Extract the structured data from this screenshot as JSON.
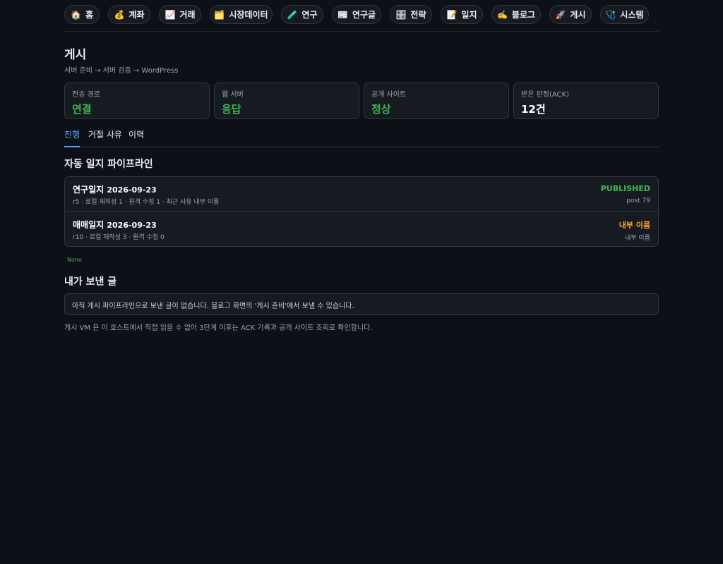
{
  "nav": [
    {
      "icon": "🏠",
      "label": "홈"
    },
    {
      "icon": "💰",
      "label": "계좌"
    },
    {
      "icon": "📈",
      "label": "거래"
    },
    {
      "icon": "🗂️",
      "label": "시장데이터"
    },
    {
      "icon": "🧪",
      "label": "연구"
    },
    {
      "icon": "📰",
      "label": "연구글"
    },
    {
      "icon": "🎛️",
      "label": "전략"
    },
    {
      "icon": "📝",
      "label": "일지"
    },
    {
      "icon": "✍️",
      "label": "블로그"
    },
    {
      "icon": "🚀",
      "label": "게시"
    },
    {
      "icon": "🩺",
      "label": "시스템"
    }
  ],
  "page": {
    "title": "게시",
    "breadcrumb": "서버 준비 → 서버 검증 → WordPress"
  },
  "cards": [
    {
      "label": "전송 경로",
      "value": "연결",
      "color": "#3fb950"
    },
    {
      "label": "웹 서버",
      "value": "응답",
      "color": "#3fb950"
    },
    {
      "label": "공개 사이트",
      "value": "정상",
      "color": "#3fb950"
    },
    {
      "label": "받은 판정(ACK)",
      "value": "12건",
      "color": "#ffffff"
    }
  ],
  "tabs": [
    {
      "label": "진행",
      "active": true
    },
    {
      "label": "거절 사유",
      "active": false
    },
    {
      "label": "이력",
      "active": false
    }
  ],
  "pipeline": {
    "title": "자동 일지 파이프라인",
    "rows": [
      {
        "name": "연구일지",
        "date": "2026-09-23",
        "meta": "r5 · 로컬 재작성 1 · 원격 수정 1 · 최근 사유 내부 이름",
        "status": "PUBLISHED",
        "status_color": "#3fb950",
        "sub": "post 79"
      },
      {
        "name": "매매일지",
        "date": "2026-09-23",
        "meta": "r10 · 로컬 재작성 3 · 원격 수정 0",
        "status": "내부 이름",
        "status_color": "#f0a030",
        "sub": "내부 이름"
      }
    ],
    "none_text": "None"
  },
  "sent": {
    "title": "내가 보낸 글",
    "empty_text": "아직 게시 파이프라인으로 보낸 글이 없습니다. 블로그 화면의 '게시 준비'에서 보낼 수 있습니다."
  },
  "footnote": "게시 VM 은 이 호스트에서 직접 읽을 수 없어 3단계 이후는 ACK 기록과 공개 사이트 조회로 확인합니다."
}
